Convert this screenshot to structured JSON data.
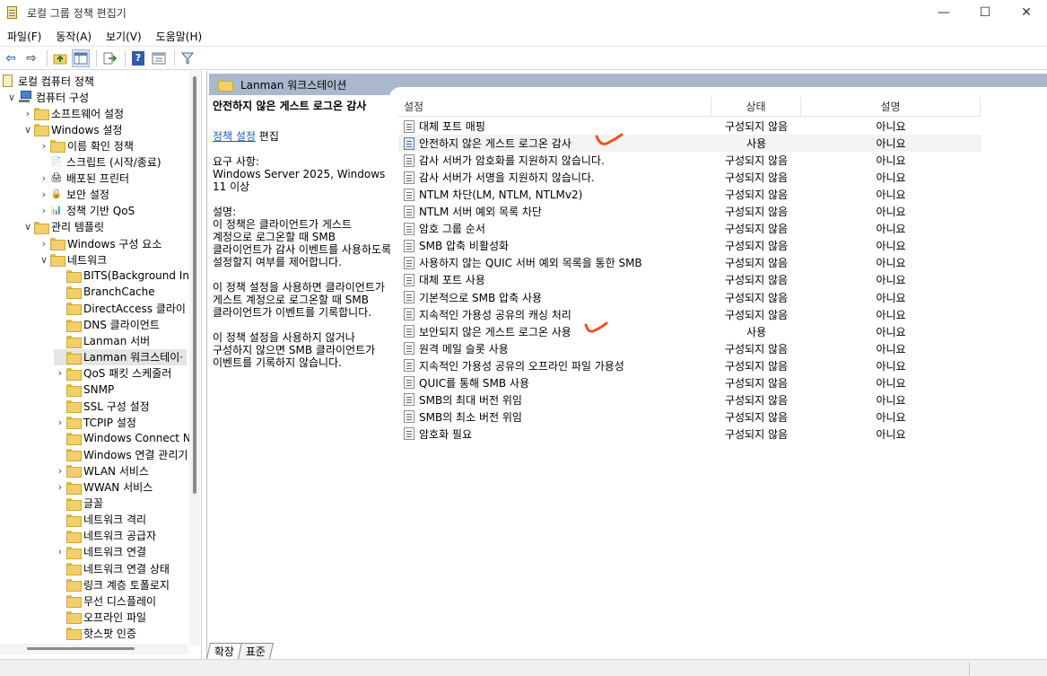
{
  "window": {
    "title": "로컬 그룹 정책 편집기",
    "minimize": "—",
    "maximize": "☐",
    "close": "✕"
  },
  "menu": [
    "파일(F)",
    "동작(A)",
    "보기(V)",
    "도움말(H)"
  ],
  "tree": {
    "items": [
      {
        "label": "로컬 컴퓨터 정책",
        "icon": "policy-icon",
        "depth": 0,
        "chevron": ""
      },
      {
        "label": "컴퓨터 구성",
        "icon": "computer-icon",
        "depth": 1,
        "chevron": "∨"
      },
      {
        "label": "소프트웨어 설정",
        "icon": "folder-icon",
        "depth": 2,
        "chevron": "›"
      },
      {
        "label": "Windows 설정",
        "icon": "folder-icon",
        "depth": 2,
        "chevron": "∨"
      },
      {
        "label": "이름 확인 정책",
        "icon": "folder-icon",
        "depth": 3,
        "chevron": "›"
      },
      {
        "label": "스크립트 (시작/종료)",
        "icon": "script-icon",
        "depth": 3,
        "chevron": ""
      },
      {
        "label": "배포된 프린터",
        "icon": "printer-icon",
        "depth": 3,
        "chevron": "›"
      },
      {
        "label": "보안 설정",
        "icon": "security-icon",
        "depth": 3,
        "chevron": "›"
      },
      {
        "label": "정책 기반 QoS",
        "icon": "chart-icon",
        "depth": 3,
        "chevron": "›"
      },
      {
        "label": "관리 템플릿",
        "icon": "folder-icon",
        "depth": 2,
        "chevron": "∨"
      },
      {
        "label": "Windows 구성 요소",
        "icon": "folder-icon",
        "depth": 3,
        "chevron": "›"
      },
      {
        "label": "네트워크",
        "icon": "folder-icon",
        "depth": 3,
        "chevron": "∨"
      },
      {
        "label": "BITS(Background Int",
        "icon": "folder-icon",
        "depth": 4,
        "chevron": ""
      },
      {
        "label": "BranchCache",
        "icon": "folder-icon",
        "depth": 4,
        "chevron": ""
      },
      {
        "label": "DirectAccess 클라이",
        "icon": "folder-icon",
        "depth": 4,
        "chevron": ""
      },
      {
        "label": "DNS 클라이언트",
        "icon": "folder-icon",
        "depth": 4,
        "chevron": ""
      },
      {
        "label": "Lanman 서버",
        "icon": "folder-icon",
        "depth": 4,
        "chevron": ""
      },
      {
        "label": "Lanman 워크스테이·",
        "icon": "folder-icon",
        "depth": 4,
        "chevron": "",
        "selected": true
      },
      {
        "label": "QoS 패킷 스케줄러",
        "icon": "folder-icon",
        "depth": 4,
        "chevron": "›"
      },
      {
        "label": "SNMP",
        "icon": "folder-icon",
        "depth": 4,
        "chevron": ""
      },
      {
        "label": "SSL 구성 설정",
        "icon": "folder-icon",
        "depth": 4,
        "chevron": ""
      },
      {
        "label": "TCPIP 설정",
        "icon": "folder-icon",
        "depth": 4,
        "chevron": "›"
      },
      {
        "label": "Windows Connect N",
        "icon": "folder-icon",
        "depth": 4,
        "chevron": ""
      },
      {
        "label": "Windows 연결 관리기",
        "icon": "folder-icon",
        "depth": 4,
        "chevron": ""
      },
      {
        "label": "WLAN 서비스",
        "icon": "folder-icon",
        "depth": 4,
        "chevron": "›"
      },
      {
        "label": "WWAN 서비스",
        "icon": "folder-icon",
        "depth": 4,
        "chevron": "›"
      },
      {
        "label": "글꼴",
        "icon": "folder-icon",
        "depth": 4,
        "chevron": ""
      },
      {
        "label": "네트워크 격리",
        "icon": "folder-icon",
        "depth": 4,
        "chevron": ""
      },
      {
        "label": "네트워크 공급자",
        "icon": "folder-icon",
        "depth": 4,
        "chevron": ""
      },
      {
        "label": "네트워크 연결",
        "icon": "folder-icon",
        "depth": 4,
        "chevron": "›"
      },
      {
        "label": "네트워크 연결 상태",
        "icon": "folder-icon",
        "depth": 4,
        "chevron": ""
      },
      {
        "label": "링크 계층 토폴로지",
        "icon": "folder-icon",
        "depth": 4,
        "chevron": ""
      },
      {
        "label": "무선 디스플레이",
        "icon": "folder-icon",
        "depth": 4,
        "chevron": ""
      },
      {
        "label": "오프라인 파일",
        "icon": "folder-icon",
        "depth": 4,
        "chevron": ""
      },
      {
        "label": "핫스팟 인증",
        "icon": "folder-icon",
        "depth": 4,
        "chevron": ""
      }
    ]
  },
  "right": {
    "header": "Lanman 워크스테이션",
    "description": {
      "title": "안전하지 않은 게스트 로그온 감사",
      "link": "정책 설정",
      "link_suffix": " 편집",
      "req_label": "요구 사항:",
      "req_value": "Windows Server 2025, Windows 11 이상",
      "desc_label": "설명:",
      "p1": "이 정책은 클라이언트가 게스트 계정으로 로그온할 때 SMB 클라이언트가 감사 이벤트를 사용하도록 설정할지 여부를 제어합니다.",
      "p2": "이 정책 설정을 사용하면 클라이언트가 게스트 계정으로 로그온할 때 SMB 클라이언트가 이벤트를 기록합니다.",
      "p3": "이 정책 설정을 사용하지 않거나 구성하지 않으면 SMB 클라이언트가 이벤트를 기록하지 않습니다."
    },
    "columns": {
      "setting": "설정",
      "state": "상태",
      "note": "설명"
    },
    "rows": [
      {
        "setting": "대체 포트 매핑",
        "state": "구성되지 않음",
        "note": "아니요"
      },
      {
        "setting": "안전하지 않은 게스트 로그온 감사",
        "state": "사용",
        "note": "아니요",
        "highlight": true,
        "blue": true
      },
      {
        "setting": "감사 서버가 암호화를 지원하지 않습니다.",
        "state": "구성되지 않음",
        "note": "아니요"
      },
      {
        "setting": "감사 서버가 서명을 지원하지 않습니다.",
        "state": "구성되지 않음",
        "note": "아니요"
      },
      {
        "setting": "NTLM 차단(LM, NTLM, NTLMv2)",
        "state": "구성되지 않음",
        "note": "아니요"
      },
      {
        "setting": "NTLM 서버 예외 목록 차단",
        "state": "구성되지 않음",
        "note": "아니요"
      },
      {
        "setting": "암호 그룹 순서",
        "state": "구성되지 않음",
        "note": "아니요"
      },
      {
        "setting": "SMB 압축 비활성화",
        "state": "구성되지 않음",
        "note": "아니요"
      },
      {
        "setting": "사용하지 않는 QUIC 서버 예외 목록을 통한 SMB",
        "state": "구성되지 않음",
        "note": "아니요"
      },
      {
        "setting": "대체 포트 사용",
        "state": "구성되지 않음",
        "note": "아니요"
      },
      {
        "setting": "기본적으로 SMB 압축 사용",
        "state": "구성되지 않음",
        "note": "아니요"
      },
      {
        "setting": "지속적인 가용성 공유의 캐싱 처리",
        "state": "구성되지 않음",
        "note": "아니요"
      },
      {
        "setting": "보안되지 않은 게스트 로그온 사용",
        "state": "사용",
        "note": "아니요"
      },
      {
        "setting": "원격 메일 슬롯 사용",
        "state": "구성되지 않음",
        "note": "아니요"
      },
      {
        "setting": "지속적인 가용성 공유의 오프라인 파일 가용성",
        "state": "구성되지 않음",
        "note": "아니요"
      },
      {
        "setting": "QUIC를 통해 SMB 사용",
        "state": "구성되지 않음",
        "note": "아니요"
      },
      {
        "setting": "SMB의 최대 버전 위임",
        "state": "구성되지 않음",
        "note": "아니요"
      },
      {
        "setting": "SMB의 최소 버전 위임",
        "state": "구성되지 않음",
        "note": "아니요"
      },
      {
        "setting": "암호화 필요",
        "state": "구성되지 않음",
        "note": "아니요"
      }
    ]
  },
  "tabs": [
    "확장",
    "표준"
  ],
  "colors": {
    "header_bg": "#a9b8cc",
    "selection": "#e5e5e5",
    "annotation": "#e8541c"
  }
}
